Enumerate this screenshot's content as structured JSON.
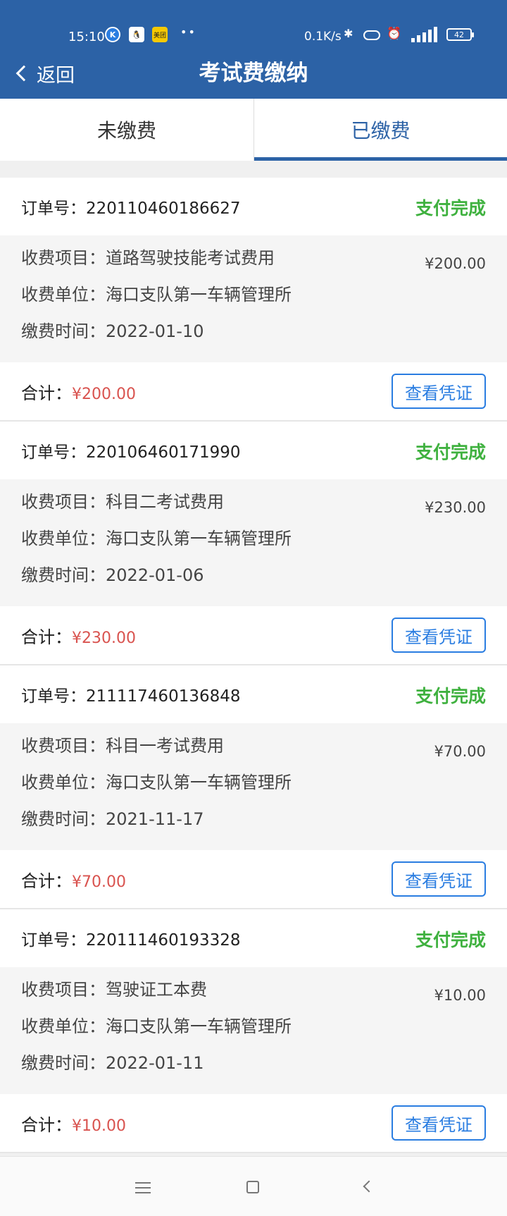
{
  "status_bar": {
    "time": "15:10",
    "net_speed": "0.1K/s",
    "battery": "42",
    "app_icons": [
      "k-app-icon",
      "qq-icon",
      "meituan-icon"
    ],
    "meituan_label": "美团"
  },
  "header": {
    "back_label": "返回",
    "title": "考试费缴纳"
  },
  "tabs": [
    {
      "label": "未缴费",
      "active": false
    },
    {
      "label": "已缴费",
      "active": true
    }
  ],
  "labels": {
    "order_no": "订单号：",
    "item": "收费项目：",
    "unit": "收费单位：",
    "time": "缴费时间：",
    "total": "合计：",
    "status": "支付完成",
    "voucher_button": "查看凭证"
  },
  "orders": [
    {
      "order_no": "220110460186627",
      "status": "支付完成",
      "item": "道路驾驶技能考试费用",
      "unit": "海口支队第一车辆管理所",
      "time": "2022-01-10",
      "amount": "¥200.00",
      "total": "¥200.00"
    },
    {
      "order_no": "220106460171990",
      "status": "支付完成",
      "item": "科目二考试费用",
      "unit": "海口支队第一车辆管理所",
      "time": "2022-01-06",
      "amount": "¥230.00",
      "total": "¥230.00"
    },
    {
      "order_no": "211117460136848",
      "status": "支付完成",
      "item": "科目一考试费用",
      "unit": "海口支队第一车辆管理所",
      "time": "2021-11-17",
      "amount": "¥70.00",
      "total": "¥70.00"
    },
    {
      "order_no": "220111460193328",
      "status": "支付完成",
      "item": "驾驶证工本费",
      "unit": "海口支队第一车辆管理所",
      "time": "2022-01-11",
      "amount": "¥10.00",
      "total": "¥10.00"
    }
  ],
  "colors": {
    "header_blue": "#2c62a6",
    "status_green": "#3fb13f",
    "money_red": "#d9534f",
    "button_blue": "#2a7de1"
  }
}
